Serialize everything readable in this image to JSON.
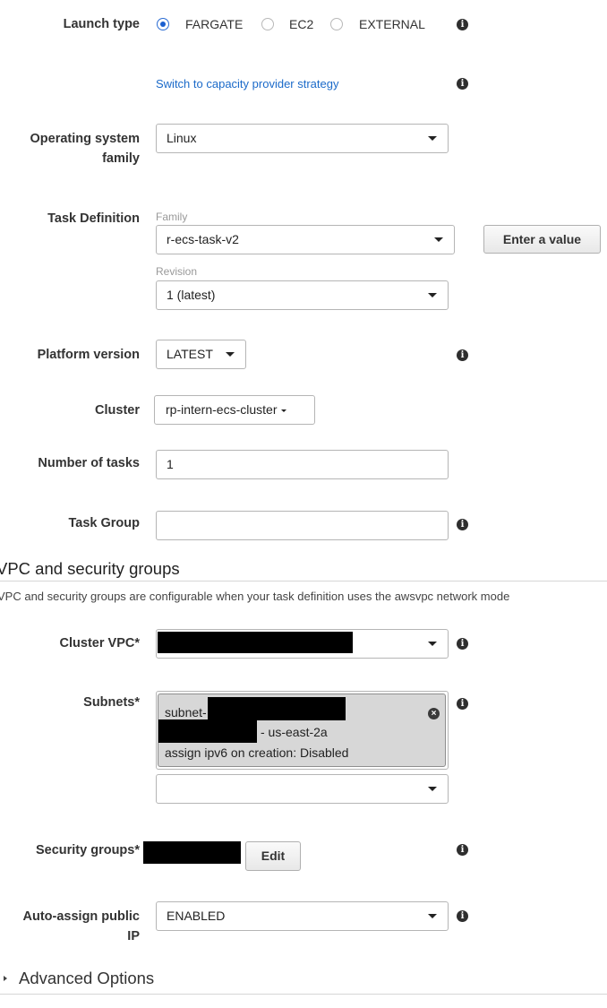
{
  "launch": {
    "label": "Launch type",
    "options": [
      "FARGATE",
      "EC2",
      "EXTERNAL"
    ],
    "selected": "FARGATE",
    "switch_link": "Switch to capacity provider strategy"
  },
  "os": {
    "label_line1": "Operating system",
    "label_line2": "family",
    "value": "Linux"
  },
  "task_def": {
    "label": "Task Definition",
    "family_label": "Family",
    "family_value": "r-ecs-task-v2",
    "enter_value_button": "Enter a value",
    "revision_label": "Revision",
    "revision_value": "1 (latest)"
  },
  "platform": {
    "label": "Platform version",
    "value": "LATEST"
  },
  "cluster": {
    "label": "Cluster",
    "value": "rp-intern-ecs-cluster"
  },
  "num_tasks": {
    "label": "Number of tasks",
    "value": "1"
  },
  "task_group": {
    "label": "Task Group",
    "value": ""
  },
  "vpc_section": {
    "title": "VPC and security groups",
    "description": "VPC and security groups are configurable when your task definition uses the awsvpc network mode"
  },
  "cluster_vpc": {
    "label": "Cluster VPC*"
  },
  "subnets": {
    "label": "Subnets*",
    "token_prefix": "subnet-",
    "token_zone": "- us-east-2a",
    "token_ipv6": "assign ipv6 on creation: Disabled",
    "add_value": ""
  },
  "security_groups": {
    "label": "Security groups*",
    "edit_button": "Edit"
  },
  "auto_assign": {
    "label_line1": "Auto-assign public",
    "label_line2": "IP",
    "value": "ENABLED"
  },
  "advanced": {
    "label": "Advanced Options"
  },
  "icons": {
    "info": "info-icon",
    "caret": "caret-down-icon",
    "remove": "remove-token-icon",
    "expand": "triangle-right-icon"
  }
}
